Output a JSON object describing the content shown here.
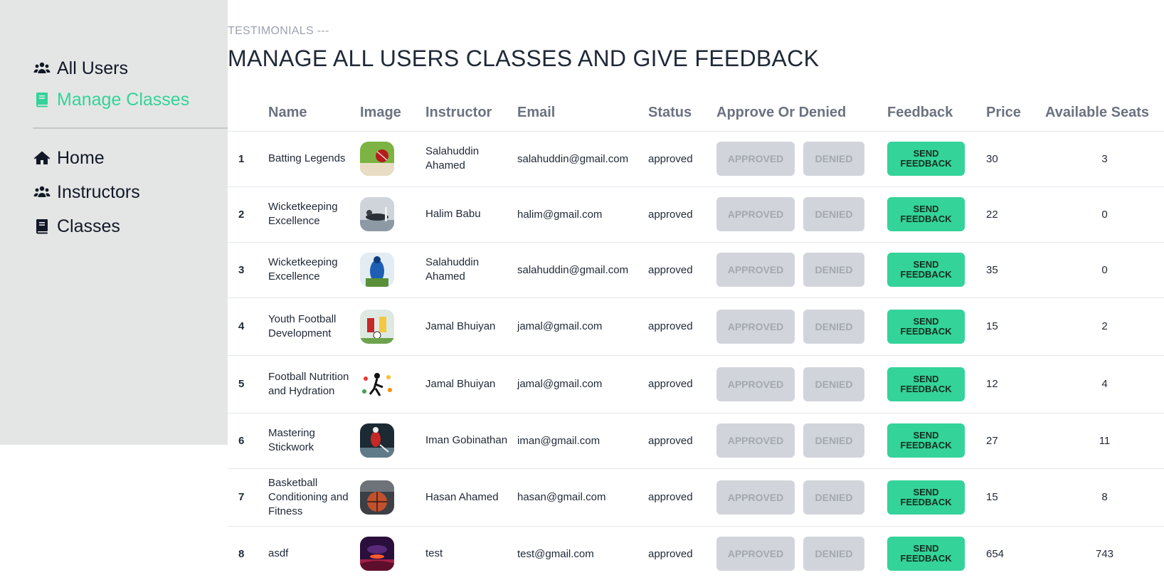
{
  "sidebar": {
    "top_items": [
      {
        "label": "All Users",
        "icon": "users-icon",
        "active": false
      },
      {
        "label": "Manage Classes",
        "icon": "book-icon",
        "active": true
      }
    ],
    "bottom_items": [
      {
        "label": "Home",
        "icon": "home-icon"
      },
      {
        "label": "Instructors",
        "icon": "users-icon"
      },
      {
        "label": "Classes",
        "icon": "book-icon"
      }
    ],
    "active_color": "#34d399"
  },
  "header": {
    "eyebrow": "TESTIMONIALS ---",
    "title": "MANAGE ALL USERS CLASSES AND GIVE FEEDBACK"
  },
  "table": {
    "columns": [
      "",
      "Name",
      "Image",
      "Instructor",
      "Email",
      "Status",
      "Approve Or Denied",
      "Feedback",
      "Price",
      "Available Seats"
    ],
    "approve_label": "APPROVED",
    "deny_label": "DENIED",
    "feedback_label": "SEND FEEDBACK",
    "rows": [
      {
        "index": "1",
        "name": "Batting Legends",
        "image": "cricket-ball-thumbnail",
        "instructor": "Salahuddin Ahamed",
        "email": "salahuddin@gmail.com",
        "status": "approved",
        "price": "30",
        "seats": "3"
      },
      {
        "index": "2",
        "name": "Wicketkeeping Excellence",
        "image": "wicketkeeper-dive-thumbnail",
        "instructor": "Halim Babu",
        "email": "halim@gmail.com",
        "status": "approved",
        "price": "22",
        "seats": "0"
      },
      {
        "index": "3",
        "name": "Wicketkeeping Excellence",
        "image": "wicketkeeper-blue-thumbnail",
        "instructor": "Salahuddin Ahamed",
        "email": "salahuddin@gmail.com",
        "status": "approved",
        "price": "35",
        "seats": "0"
      },
      {
        "index": "4",
        "name": "Youth Football Development",
        "image": "football-players-thumbnail",
        "instructor": "Jamal Bhuiyan",
        "email": "jamal@gmail.com",
        "status": "approved",
        "price": "15",
        "seats": "2"
      },
      {
        "index": "5",
        "name": "Football Nutrition and Hydration",
        "image": "football-nutrition-thumbnail",
        "instructor": "Jamal Bhuiyan",
        "email": "jamal@gmail.com",
        "status": "approved",
        "price": "12",
        "seats": "4"
      },
      {
        "index": "6",
        "name": "Mastering Stickwork",
        "image": "hockey-player-thumbnail",
        "instructor": "Iman Gobinathan",
        "email": "iman@gmail.com",
        "status": "approved",
        "price": "27",
        "seats": "11"
      },
      {
        "index": "7",
        "name": "Basketball Conditioning and Fitness",
        "image": "basketball-thumbnail",
        "instructor": "Hasan Ahamed",
        "email": "hasan@gmail.com",
        "status": "approved",
        "price": "15",
        "seats": "8"
      },
      {
        "index": "8",
        "name": "asdf",
        "image": "purple-landscape-thumbnail",
        "instructor": "test",
        "email": "test@gmail.com",
        "status": "approved",
        "price": "654",
        "seats": "743"
      }
    ]
  }
}
